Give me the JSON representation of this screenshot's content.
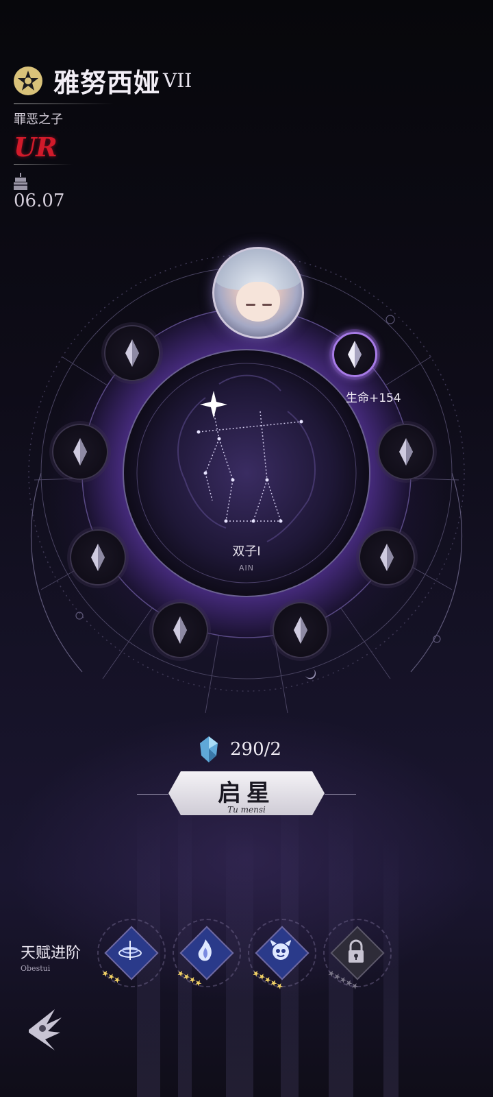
{
  "character": {
    "name": "雅努西娅",
    "rank": "VII",
    "title": "罪恶之子",
    "rarity": "UR",
    "birthday": "06.07"
  },
  "constellation": {
    "name": "双子I",
    "subtitle": "AIN",
    "bonus_text": "生命+154"
  },
  "cost": {
    "value": "290/2",
    "icon": "crystal-icon"
  },
  "action": {
    "label": "启星",
    "sub_label": "Tu mensi"
  },
  "talent": {
    "label": "天赋进阶",
    "sub_label": "Obestui",
    "skills": [
      {
        "icon": "vortex-skill-icon",
        "stars_filled": 3,
        "stars_total": 3,
        "locked": false
      },
      {
        "icon": "flame-skill-icon",
        "stars_filled": 4,
        "stars_total": 4,
        "locked": false
      },
      {
        "icon": "spirit-skill-icon",
        "stars_filled": 5,
        "stars_total": 5,
        "locked": false
      },
      {
        "icon": "lock-icon",
        "stars_filled": 0,
        "stars_total": 5,
        "locked": true
      }
    ]
  },
  "colors": {
    "accent_purple": "#a77be6",
    "rarity_red": "#d11a2a",
    "star_gold": "#f2d266",
    "star_gray": "#7a7688"
  }
}
